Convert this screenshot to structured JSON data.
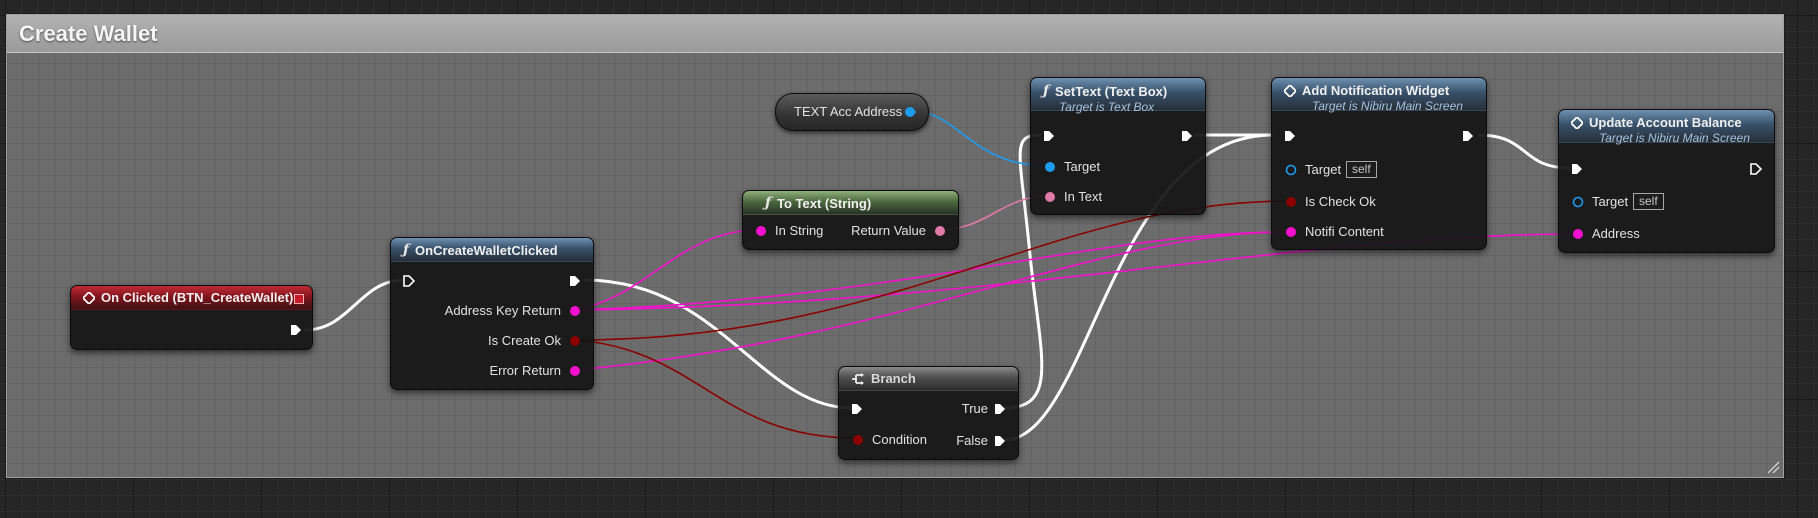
{
  "comment": {
    "title": "Create Wallet"
  },
  "nodes": {
    "on_clicked": {
      "title": "On Clicked (BTN_CreateWallet)"
    },
    "on_create_wallet_clicked": {
      "title": "OnCreateWalletClicked",
      "pins": {
        "address_key_return": "Address Key Return",
        "is_create_ok": "Is Create Ok",
        "error_return": "Error Return"
      }
    },
    "text_acc_address": {
      "title": "TEXT Acc Address"
    },
    "to_text": {
      "title": "To Text (String)",
      "pins": {
        "in_string": "In String",
        "return_value": "Return Value"
      }
    },
    "set_text": {
      "title": "SetText (Text Box)",
      "subtitle": "Target is Text Box",
      "pins": {
        "target": "Target",
        "in_text": "In Text"
      }
    },
    "branch": {
      "title": "Branch",
      "pins": {
        "condition": "Condition",
        "true": "True",
        "false": "False"
      }
    },
    "add_notification": {
      "title": "Add Notification Widget",
      "subtitle": "Target is Nibiru Main Screen",
      "pins": {
        "target": "Target",
        "target_default": "self",
        "is_check_ok": "Is Check Ok",
        "notifi_content": "Notifi Content"
      }
    },
    "update_balance": {
      "title": "Update Account Balance",
      "subtitle": "Target is Nibiru Main Screen",
      "pins": {
        "target": "Target",
        "target_default": "self",
        "address": "Address"
      }
    }
  },
  "colors": {
    "exec": "#ffffff",
    "string": "#f50fce",
    "bool": "#8c0000",
    "object": "#1b9cee",
    "text": "#e07aa6"
  },
  "icons": {
    "function": "function-icon",
    "event": "event-icon",
    "branch": "branch-icon",
    "stop": "stop-icon"
  }
}
